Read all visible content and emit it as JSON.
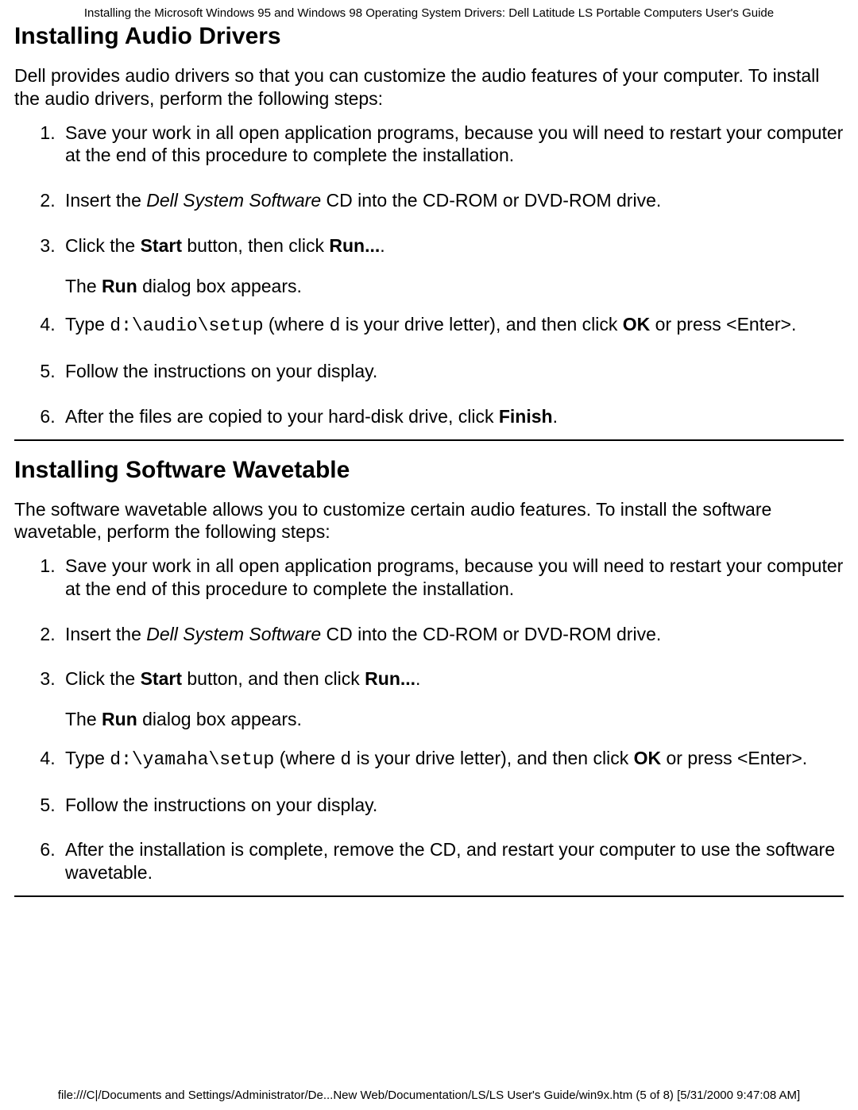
{
  "header": {
    "title": "Installing the Microsoft Windows 95 and Windows 98 Operating System Drivers: Dell Latitude LS Portable Computers User's Guide"
  },
  "audio": {
    "heading": "Installing Audio Drivers",
    "intro": "Dell provides audio drivers so that you can customize the audio features of your computer. To install the audio drivers, perform the following steps:",
    "steps": {
      "s1": "Save your work in all open application programs, because you will need to restart your computer at the end of this procedure to complete the installation.",
      "s2_a": "Insert the ",
      "s2_em": "Dell System Software",
      "s2_b": " CD into the CD-ROM or DVD-ROM drive.",
      "s3_a": "Click the ",
      "s3_b1": "Start",
      "s3_c": " button, then click ",
      "s3_b2": "Run...",
      "s3_d": ".",
      "s3_after_a": "The ",
      "s3_after_b": "Run",
      "s3_after_c": " dialog box appears.",
      "s4_a": "Type ",
      "s4_code1": "d:\\audio\\setup",
      "s4_b": " (where ",
      "s4_code2": "d",
      "s4_c": " is your drive letter), and then click ",
      "s4_bold": "OK",
      "s4_d": " or press <Enter>.",
      "s5": "Follow the instructions on your display.",
      "s6_a": "After the files are copied to your hard-disk drive, click ",
      "s6_b": "Finish",
      "s6_c": "."
    }
  },
  "wavetable": {
    "heading": "Installing Software Wavetable",
    "intro": "The software wavetable allows you to customize certain audio features. To install the software wavetable, perform the following steps:",
    "steps": {
      "s1": "Save your work in all open application programs, because you will need to restart your computer at the end of this procedure to complete the installation.",
      "s2_a": "Insert the ",
      "s2_em": "Dell System Software",
      "s2_b": " CD into the CD-ROM or DVD-ROM drive.",
      "s3_a": "Click the ",
      "s3_b1": "Start",
      "s3_c": " button, and then click ",
      "s3_b2": "Run...",
      "s3_d": ".",
      "s3_after_a": "The ",
      "s3_after_b": "Run",
      "s3_after_c": " dialog box appears.",
      "s4_a": "Type ",
      "s4_code1": "d:\\yamaha\\setup",
      "s4_b": " (where ",
      "s4_code2": "d",
      "s4_c": " is your drive letter), and then click ",
      "s4_bold": "OK",
      "s4_d": " or press <Enter>.",
      "s5": "Follow the instructions on your display.",
      "s6": "After the installation is complete, remove the CD, and restart your computer to use the software wavetable."
    }
  },
  "footer": {
    "text": "file:///C|/Documents and Settings/Administrator/De...New Web/Documentation/LS/LS User's Guide/win9x.htm (5 of 8) [5/31/2000 9:47:08 AM]"
  }
}
